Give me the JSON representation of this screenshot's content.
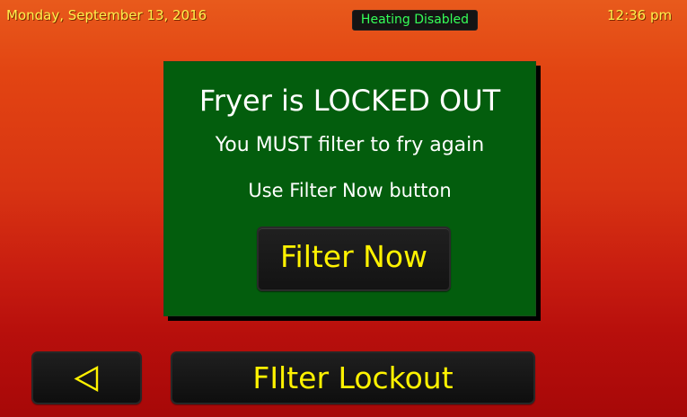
{
  "status_bar": {
    "date": "Monday, September 13, 2016",
    "heating_status": "Heating Disabled",
    "time": "12:36 pm"
  },
  "lockout_panel": {
    "title": "Fryer is LOCKED OUT",
    "message": "You MUST filter to fry again",
    "instruction": "Use Filter Now button",
    "filter_now_label": "Filter Now"
  },
  "footer": {
    "title": "FIlter Lockout",
    "back_icon": "back-triangle-icon"
  },
  "colors": {
    "background_top": "#e85a1c",
    "background_bottom": "#a70808",
    "panel_green": "#035d0d",
    "status_yellow": "#fff04d",
    "button_yellow": "#fff200",
    "heating_green": "#35ff58",
    "button_black": "#131313"
  }
}
